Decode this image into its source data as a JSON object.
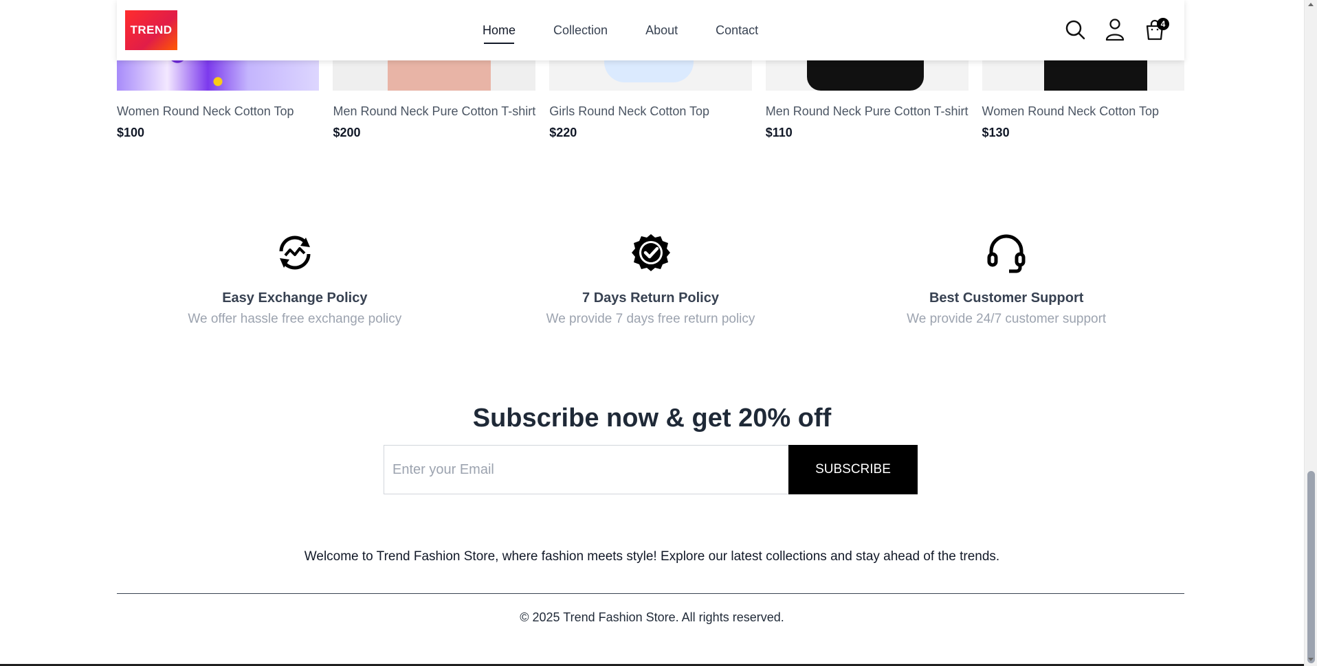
{
  "header": {
    "logo_text": "TREND",
    "nav": [
      {
        "label": "Home",
        "active": true
      },
      {
        "label": "Collection",
        "active": false
      },
      {
        "label": "About",
        "active": false
      },
      {
        "label": "Contact",
        "active": false
      }
    ],
    "icons": [
      "search-icon",
      "user-icon",
      "cart-icon"
    ],
    "cart_count": "4"
  },
  "products": [
    {
      "name": "Women Round Neck Cotton Top",
      "price": "$100"
    },
    {
      "name": "Men Round Neck Pure Cotton T-shirt",
      "price": "$200"
    },
    {
      "name": "Girls Round Neck Cotton Top",
      "price": "$220"
    },
    {
      "name": "Men Round Neck Pure Cotton T-shirt",
      "price": "$110"
    },
    {
      "name": "Women Round Neck Cotton Top",
      "price": "$130"
    }
  ],
  "policies": [
    {
      "icon": "exchange-icon",
      "title": "Easy Exchange Policy",
      "desc": "We offer hassle free exchange policy"
    },
    {
      "icon": "verified-badge-icon",
      "title": "7 Days Return Policy",
      "desc": "We provide 7 days free return policy"
    },
    {
      "icon": "headset-icon",
      "title": "Best Customer Support",
      "desc": "We provide 24/7 customer support"
    }
  ],
  "subscribe": {
    "heading": "Subscribe now & get 20% off",
    "placeholder": "Enter your Email",
    "button": "SUBSCRIBE"
  },
  "footer": {
    "text": "Welcome to Trend Fashion Store, where fashion meets style! Explore our latest collections and stay ahead of the trends.",
    "copyright": "© 2025 Trend Fashion Store. All rights reserved."
  },
  "colors": {
    "accent": "#000000",
    "logo_bg": "#e11d48",
    "muted_text": "#9ca3af"
  }
}
